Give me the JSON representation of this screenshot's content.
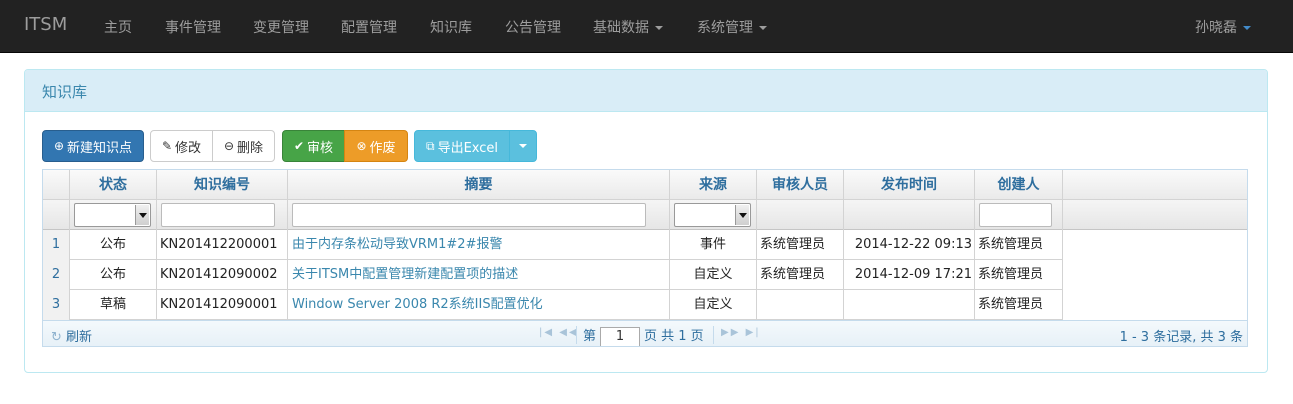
{
  "navbar": {
    "brand": "ITSM",
    "items": [
      "主页",
      "事件管理",
      "变更管理",
      "配置管理",
      "知识库",
      "公告管理"
    ],
    "dropdowns": [
      "基础数据",
      "系统管理"
    ],
    "user": "孙晓磊"
  },
  "panel": {
    "title": "知识库"
  },
  "toolbar": {
    "new": "新建知识点",
    "edit": "修改",
    "delete": "删除",
    "approve": "审核",
    "void": "作废",
    "export": "导出Excel"
  },
  "grid": {
    "columns": [
      "状态",
      "知识编号",
      "摘要",
      "来源",
      "审核人员",
      "发布时间",
      "创建人"
    ],
    "rows": [
      {
        "num": "1",
        "status": "公布",
        "code": "KN201412200001",
        "summary": "由于内存条松动导致VRM1#2#报警",
        "source": "事件",
        "reviewer": "系统管理员",
        "published": "2014-12-22 09:13",
        "creator": "系统管理员"
      },
      {
        "num": "2",
        "status": "公布",
        "code": "KN201412090002",
        "summary": "关于ITSM中配置管理新建配置项的描述",
        "source": "自定义",
        "reviewer": "系统管理员",
        "published": "2014-12-09 17:21",
        "creator": "系统管理员"
      },
      {
        "num": "3",
        "status": "草稿",
        "code": "KN201412090001",
        "summary": "Window Server 2008 R2系统IIS配置优化",
        "source": "自定义",
        "reviewer": "",
        "published": "",
        "creator": "系统管理员"
      }
    ]
  },
  "pager": {
    "refresh": "刷新",
    "page_prefix": "第",
    "page": "1",
    "page_suffix": "页 共 1 页",
    "info": "1 - 3 条记录, 共 3 条"
  }
}
